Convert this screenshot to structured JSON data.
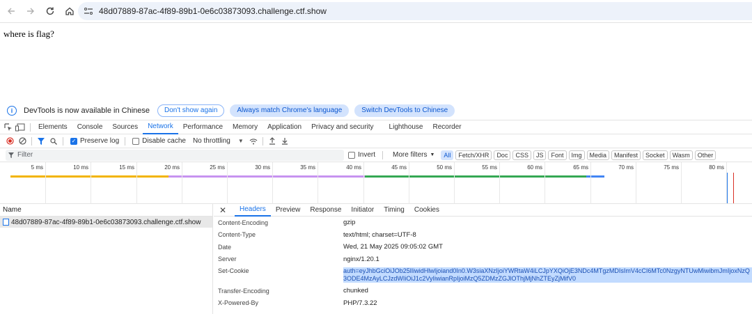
{
  "browser": {
    "url": "48d07889-87ac-4f89-89b1-0e6c03873093.challenge.ctf.show"
  },
  "page": {
    "text": "where is flag?"
  },
  "devtools": {
    "infobar": {
      "message": "DevTools is now available in Chinese",
      "dont_show": "Don't show again",
      "match_lang": "Always match Chrome's language",
      "switch": "Switch DevTools to Chinese"
    },
    "tabs": [
      "Elements",
      "Console",
      "Sources",
      "Network",
      "Performance",
      "Memory",
      "Application",
      "Privacy and security",
      "Lighthouse",
      "Recorder"
    ],
    "active_tab": "Network",
    "toolbar": {
      "preserve_log": "Preserve log",
      "disable_cache": "Disable cache",
      "throttling": "No throttling"
    },
    "filter": {
      "placeholder": "Filter",
      "invert": "Invert",
      "more_filters": "More filters",
      "chips": [
        "All",
        "Fetch/XHR",
        "Doc",
        "CSS",
        "JS",
        "Font",
        "Img",
        "Media",
        "Manifest",
        "Socket",
        "Wasm",
        "Other"
      ]
    },
    "timeline": {
      "ticks": [
        "5 ms",
        "10 ms",
        "15 ms",
        "20 ms",
        "25 ms",
        "30 ms",
        "35 ms",
        "40 ms",
        "45 ms",
        "50 ms",
        "55 ms",
        "60 ms",
        "65 ms",
        "70 ms",
        "75 ms",
        "80 ms"
      ]
    },
    "requests": {
      "header": "Name",
      "rows": [
        "48d07889-87ac-4f89-89b1-0e6c03873093.challenge.ctf.show"
      ]
    },
    "detail": {
      "tabs": [
        "Headers",
        "Preview",
        "Response",
        "Initiator",
        "Timing",
        "Cookies"
      ],
      "active_tab": "Headers",
      "headers": [
        {
          "name": "Content-Encoding",
          "value": "gzip"
        },
        {
          "name": "Content-Type",
          "value": "text/html; charset=UTF-8"
        },
        {
          "name": "Date",
          "value": "Wed, 21 May 2025 09:05:02 GMT"
        },
        {
          "name": "Server",
          "value": "nginx/1.20.1"
        },
        {
          "name": "Set-Cookie",
          "value": "auth=eyJhbGciOiJOb25lIiwidHlwIjoiand0In0.W3siaXNzIjoiYWRtaW4iLCJpYXQiOjE3NDc4MTgzMDIsImV4cCI6MTc0NzgyNTUwMiwibmJmIjoxNzQ3ODE4MzAyLCJzdWIiOiJ1c2VyIiwianRpIjoiMzQ5ZDMzZGJlOThjMjNhZTEyZjMifV0"
        },
        {
          "name": "Transfer-Encoding",
          "value": "chunked"
        },
        {
          "name": "X-Powered-By",
          "value": "PHP/7.3.22"
        }
      ]
    }
  }
}
